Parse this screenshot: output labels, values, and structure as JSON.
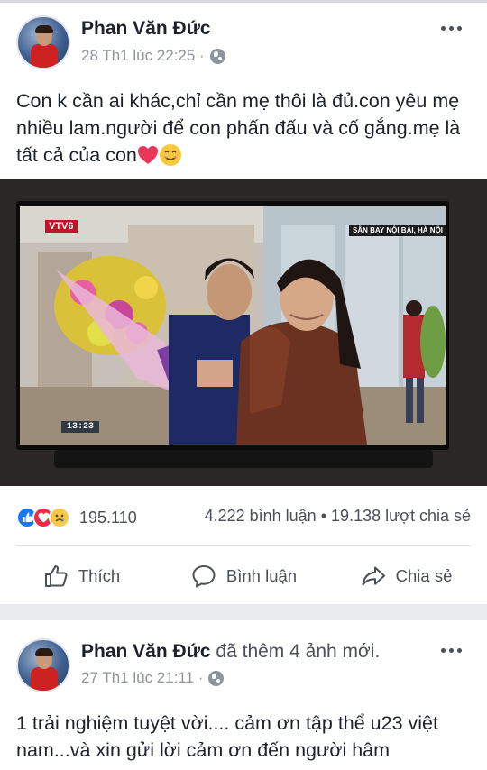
{
  "post1": {
    "author": "Phan Văn Đức",
    "timestamp": "28 Th1 lúc 22:25 ·",
    "privacy_icon": "globe-icon",
    "text": "Con k cần ai khác,chỉ cần mẹ thôi là đủ.con yêu mẹ nhiều lam.người để con phấn đấu và cố gắng.mẹ là tất cả của con",
    "photo": {
      "channel_logo": "VTV6",
      "location_banner": "SÂN BAY NỘI BÀI, HÀ NỘI",
      "clock": "13:23"
    },
    "reaction_count": "195.110",
    "reaction_icons": [
      "like-icon",
      "love-icon",
      "sad-icon"
    ],
    "comments": "4.222 bình luận",
    "stats_separator": "•",
    "shares": "19.138 lượt chia sẻ",
    "actions": {
      "like": "Thích",
      "comment": "Bình luận",
      "share": "Chia sẻ"
    }
  },
  "post2": {
    "author": "Phan Văn Đức",
    "action": "đã thêm 4 ảnh mới.",
    "timestamp": "27 Th1 lúc 21:11 ·",
    "privacy_icon": "globe-icon",
    "text": "1 trải nghiệm tuyệt vời.... cảm ơn tập thể u23 việt nam...và xin gửi lời cảm ơn đến người hâm"
  },
  "colors": {
    "like_blue": "#1877f2",
    "love_red": "#f0284a",
    "sad_yellow": "#f7c948",
    "text_primary": "#1d2129",
    "text_secondary": "#90949c"
  }
}
